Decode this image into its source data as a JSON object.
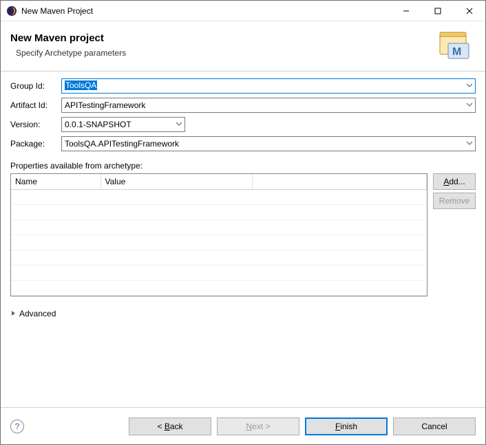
{
  "window": {
    "title": "New Maven Project"
  },
  "banner": {
    "title": "New Maven project",
    "subtitle": "Specify Archetype parameters"
  },
  "labels": {
    "groupId": "Group Id:",
    "artifactId": "Artifact Id:",
    "version": "Version:",
    "package": "Package:",
    "props": "Properties available from archetype:",
    "advanced": "Advanced"
  },
  "values": {
    "groupId": "ToolsQA",
    "artifactId": "APITestingFramework",
    "version": "0.0.1-SNAPSHOT",
    "package": "ToolsQA.APITestingFramework"
  },
  "table": {
    "col_name": "Name",
    "col_value": "Value"
  },
  "buttons": {
    "add": "Add...",
    "remove": "Remove",
    "back": "Back",
    "next": "Next >",
    "finish": "Finish",
    "cancel": "Cancel"
  }
}
